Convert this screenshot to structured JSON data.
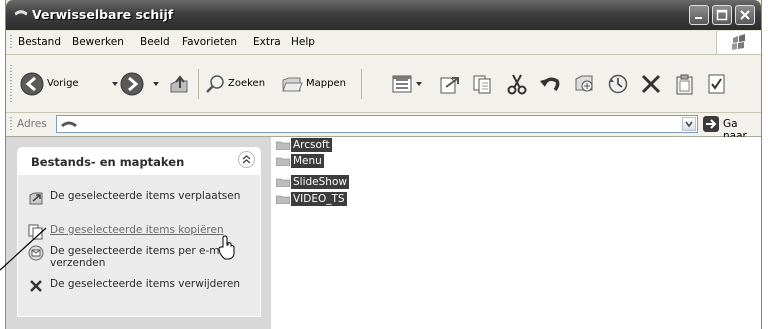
{
  "window": {
    "title": "Verwisselbare schijf"
  },
  "menu": [
    "Bestand",
    "Bewerken",
    "Beeld",
    "Favorieten",
    "Extra",
    "Help"
  ],
  "toolbar": {
    "back_label": "Vorige",
    "search_label": "Zoeken",
    "folders_label": "Mappen"
  },
  "address": {
    "label": "Adres",
    "value": "",
    "go_label": "Ga naar"
  },
  "tasks": {
    "title": "Bestands- en maptaken",
    "items": [
      {
        "label": "De geselecteerde items verplaatsen",
        "icon": "move-icon"
      },
      {
        "label": "De geselecteerde items kopiëren",
        "icon": "copy-icon"
      },
      {
        "label": "De geselecteerde items per e-mail verzenden",
        "icon": "email-icon"
      },
      {
        "label": "De geselecteerde items verwijderen",
        "icon": "delete-icon"
      }
    ]
  },
  "folders": [
    "Arcsoft",
    "Menu",
    "SlideShow",
    "VIDEO_TS"
  ],
  "colors": {
    "selection": "#3c3c3c",
    "titlebar": "#3f3f3f",
    "panel": "#ebebeb"
  }
}
